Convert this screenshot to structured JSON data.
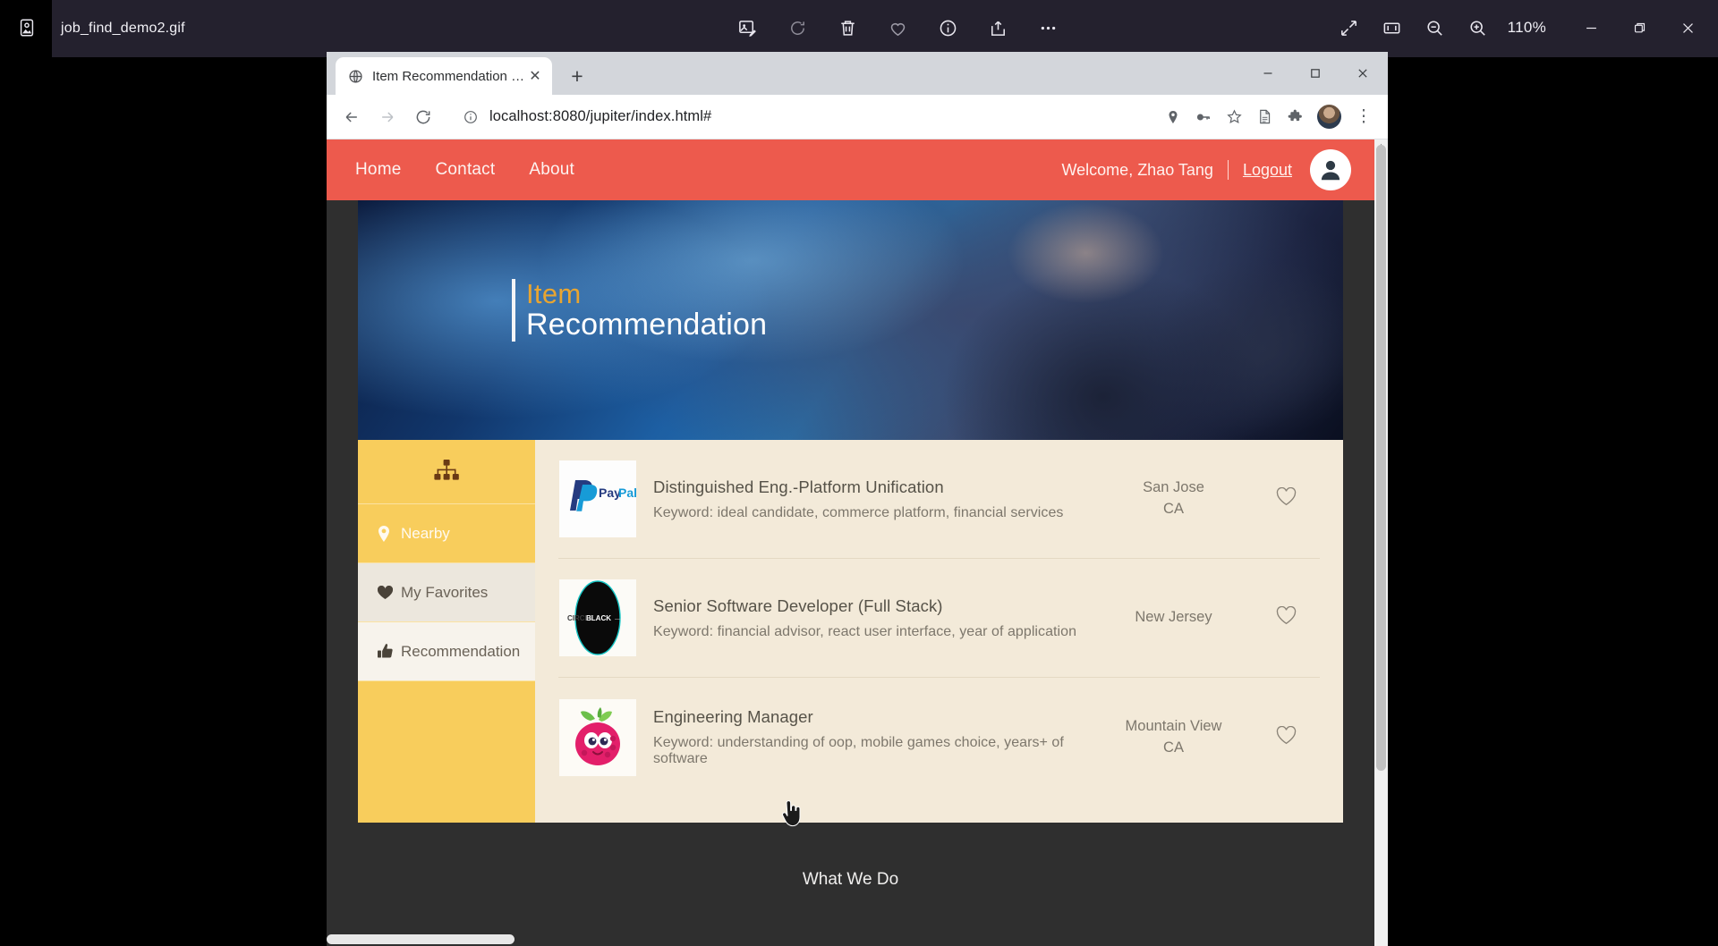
{
  "photos_app": {
    "file_name": "job_find_demo2.gif",
    "zoom_level": "110%",
    "app_icon": "photo-app-icon",
    "center_tools": [
      {
        "name": "edit-image-icon",
        "label": "Edit image"
      },
      {
        "name": "rotate-icon",
        "label": "Rotate"
      },
      {
        "name": "delete-icon",
        "label": "Delete"
      },
      {
        "name": "favorite-heart-icon",
        "label": "Add to favorites"
      },
      {
        "name": "info-icon",
        "label": "File info"
      },
      {
        "name": "share-icon",
        "label": "Share"
      },
      {
        "name": "more-options-icon",
        "label": "See more"
      }
    ],
    "right_tools": [
      {
        "name": "expand-icon",
        "label": "Expand"
      },
      {
        "name": "fit-to-window-icon",
        "label": "Fit to window"
      },
      {
        "name": "zoom-out-icon",
        "label": "Zoom out"
      },
      {
        "name": "zoom-in-icon",
        "label": "Zoom in"
      }
    ],
    "window_controls": [
      {
        "name": "minimize-button",
        "glyph": "─"
      },
      {
        "name": "restore-button",
        "glyph": "❐"
      },
      {
        "name": "close-button",
        "glyph": "✕"
      }
    ]
  },
  "browser": {
    "tab": {
      "title": "Item Recommendation Final",
      "close_glyph": "✕"
    },
    "new_tab_glyph": "+",
    "window_controls": [
      {
        "name": "browser-minimize-button",
        "glyph": "─"
      },
      {
        "name": "browser-maximize-button",
        "glyph": "☐"
      },
      {
        "name": "browser-close-button",
        "glyph": "✕"
      }
    ],
    "nav": {
      "back_glyph": "←",
      "forward_glyph": "→",
      "reload_glyph": "⟳"
    },
    "url": "localhost:8080/jupiter/index.html#",
    "omnibox_icons": [
      {
        "name": "location-pin-icon"
      },
      {
        "name": "key-icon"
      },
      {
        "name": "bookmark-star-icon"
      },
      {
        "name": "reading-list-icon"
      },
      {
        "name": "extensions-puzzle-icon"
      }
    ],
    "menu_glyph": "⋮"
  },
  "site": {
    "navbar": {
      "links": [
        {
          "label": "Home"
        },
        {
          "label": "Contact"
        },
        {
          "label": "About"
        }
      ],
      "welcome": "Welcome, Zhao Tang",
      "divider": "|",
      "logout": "Logout",
      "avatar_name": "user-avatar",
      "bg_color": "#ed5a4d"
    },
    "hero": {
      "line1": "Item",
      "line2": "Recommendation"
    },
    "sidebar": {
      "top_icon": "sitemap-icon",
      "bg_color": "#f8cd5c",
      "items": [
        {
          "label": "Nearby",
          "icon": "map-pin-icon",
          "state": "active"
        },
        {
          "label": "My Favorites",
          "icon": "heart-icon",
          "state": "inactive"
        },
        {
          "label": "Recommendation",
          "icon": "thumbs-up-icon",
          "state": "inactive"
        }
      ]
    },
    "items": [
      {
        "logo": "paypal-logo",
        "title": "Distinguished Eng.-Platform Unification",
        "keyword": "Keyword: ideal candidate, commerce platform, financial services",
        "city": "San Jose",
        "state": "CA",
        "favorite_icon": "heart-outline-icon"
      },
      {
        "logo": "circle-black-logo",
        "title": "Senior Software Developer (Full Stack)",
        "keyword": "Keyword: financial advisor, react user interface, year of application",
        "city": "New Jersey",
        "state": "",
        "favorite_icon": "heart-outline-icon"
      },
      {
        "logo": "raspberry-logo",
        "title": "Engineering Manager",
        "keyword": "Keyword: understanding of oop, mobile games choice, years+ of software",
        "city": "Mountain View",
        "state": "CA",
        "favorite_icon": "heart-outline-icon"
      }
    ],
    "footer": {
      "what_we_do": "What We Do"
    }
  }
}
